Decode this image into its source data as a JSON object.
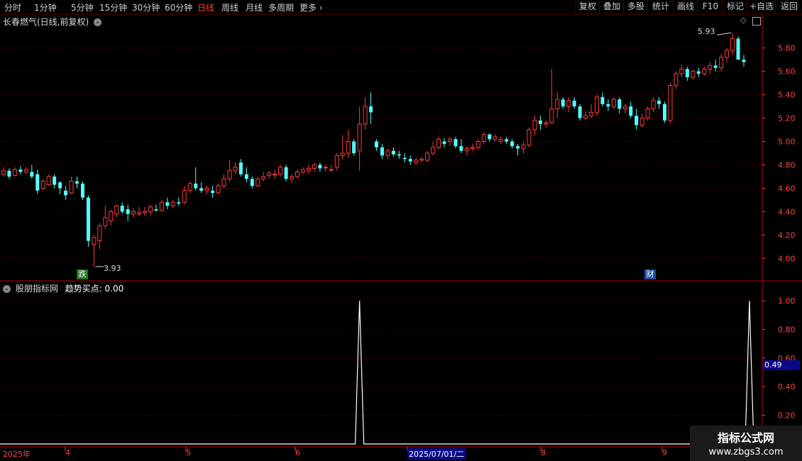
{
  "toolbar": {
    "timeframes": [
      "分时",
      "1分钟",
      "5分钟",
      "15分钟",
      "30分钟",
      "60分钟",
      "日线",
      "周线",
      "月线",
      "多周期",
      "更多"
    ],
    "active_timeframe": "日线",
    "right_buttons": [
      "复权",
      "叠加",
      "多股",
      "统计",
      "画线",
      "F10",
      "+自选",
      "返回"
    ]
  },
  "main_panel": {
    "title": "长春燃气(日线,前复权)",
    "high_label": "5.93",
    "low_label": "3.93",
    "marker_left": "跌",
    "marker_right": "财"
  },
  "indicator_panel": {
    "title": "股朋指标网",
    "series_label": "趋势买点: 0.00",
    "cursor_value": "0.49"
  },
  "date_axis": {
    "labels": [
      "2025年",
      "4",
      "5",
      "6",
      "2025/07/01/二",
      "8",
      "9"
    ]
  },
  "watermark": {
    "line1": "指标公式网",
    "line2": "www.zbgs3.com"
  },
  "colors": {
    "up": "#ff3b3b",
    "down": "#54ffff",
    "grid": "#7a0000",
    "axis": "#ff4444",
    "indicator": "#ffffff"
  },
  "chart_data": [
    {
      "type": "candlestick",
      "title": "长春燃气(日线,前复权)",
      "ylim": [
        3.82,
        5.98
      ],
      "y_ticks": [
        4.0,
        4.2,
        4.4,
        4.6,
        4.8,
        5.0,
        5.2,
        5.4,
        5.6,
        5.8
      ],
      "x_tick_labels": [
        "2025年",
        "4",
        "5",
        "6",
        "2025/07/01/二",
        "8",
        "9"
      ],
      "annotations": [
        {
          "text": "5.93",
          "type": "high"
        },
        {
          "text": "3.93",
          "type": "low"
        }
      ],
      "ohlc": [
        [
          4.72,
          4.78,
          4.7,
          4.75
        ],
        [
          4.75,
          4.77,
          4.68,
          4.7
        ],
        [
          4.71,
          4.78,
          4.7,
          4.76
        ],
        [
          4.76,
          4.79,
          4.72,
          4.74
        ],
        [
          4.74,
          4.78,
          4.72,
          4.76
        ],
        [
          4.74,
          4.8,
          4.68,
          4.7
        ],
        [
          4.72,
          4.76,
          4.55,
          4.58
        ],
        [
          4.6,
          4.68,
          4.58,
          4.66
        ],
        [
          4.63,
          4.72,
          4.62,
          4.7
        ],
        [
          4.7,
          4.72,
          4.6,
          4.63
        ],
        [
          4.65,
          4.66,
          4.55,
          4.6
        ],
        [
          4.58,
          4.62,
          4.5,
          4.54
        ],
        [
          4.56,
          4.7,
          4.55,
          4.66
        ],
        [
          4.66,
          4.7,
          4.6,
          4.64
        ],
        [
          4.64,
          4.66,
          4.5,
          4.52
        ],
        [
          4.52,
          4.54,
          4.1,
          4.15
        ],
        [
          4.12,
          4.2,
          3.93,
          4.18
        ],
        [
          4.15,
          4.3,
          4.08,
          4.28
        ],
        [
          4.28,
          4.45,
          4.25,
          4.35
        ],
        [
          4.32,
          4.42,
          4.28,
          4.4
        ],
        [
          4.38,
          4.46,
          4.35,
          4.45
        ],
        [
          4.45,
          4.48,
          4.38,
          4.4
        ],
        [
          4.42,
          4.46,
          4.32,
          4.38
        ],
        [
          4.38,
          4.43,
          4.35,
          4.4
        ],
        [
          4.38,
          4.44,
          4.36,
          4.39
        ],
        [
          4.39,
          4.44,
          4.36,
          4.4
        ],
        [
          4.4,
          4.46,
          4.37,
          4.44
        ],
        [
          4.42,
          4.46,
          4.4,
          4.41
        ],
        [
          4.41,
          4.5,
          4.4,
          4.48
        ],
        [
          4.48,
          4.52,
          4.42,
          4.45
        ],
        [
          4.45,
          4.5,
          4.43,
          4.48
        ],
        [
          4.48,
          4.52,
          4.45,
          4.47
        ],
        [
          4.48,
          4.62,
          4.46,
          4.58
        ],
        [
          4.58,
          4.66,
          4.56,
          4.64
        ],
        [
          4.64,
          4.78,
          4.58,
          4.6
        ],
        [
          4.6,
          4.65,
          4.56,
          4.58
        ],
        [
          4.58,
          4.62,
          4.55,
          4.6
        ],
        [
          4.58,
          4.62,
          4.52,
          4.56
        ],
        [
          4.56,
          4.64,
          4.55,
          4.62
        ],
        [
          4.62,
          4.72,
          4.6,
          4.68
        ],
        [
          4.68,
          4.84,
          4.66,
          4.75
        ],
        [
          4.75,
          4.82,
          4.72,
          4.78
        ],
        [
          4.82,
          4.85,
          4.7,
          4.72
        ],
        [
          4.72,
          4.78,
          4.65,
          4.68
        ],
        [
          4.68,
          4.7,
          4.6,
          4.62
        ],
        [
          4.62,
          4.7,
          4.61,
          4.68
        ],
        [
          4.68,
          4.74,
          4.66,
          4.7
        ],
        [
          4.71,
          4.75,
          4.68,
          4.73
        ],
        [
          4.72,
          4.76,
          4.68,
          4.72
        ],
        [
          4.72,
          4.8,
          4.7,
          4.78
        ],
        [
          4.78,
          4.8,
          4.66,
          4.68
        ],
        [
          4.68,
          4.72,
          4.64,
          4.7
        ],
        [
          4.7,
          4.76,
          4.68,
          4.74
        ],
        [
          4.74,
          4.78,
          4.72,
          4.76
        ],
        [
          4.75,
          4.8,
          4.72,
          4.77
        ],
        [
          4.77,
          4.82,
          4.74,
          4.8
        ],
        [
          4.8,
          4.82,
          4.74,
          4.77
        ],
        [
          4.78,
          4.8,
          4.74,
          4.78
        ],
        [
          4.76,
          4.8,
          4.74,
          4.76
        ],
        [
          4.78,
          4.9,
          4.75,
          4.88
        ],
        [
          4.88,
          5.05,
          4.85,
          4.9
        ],
        [
          4.9,
          5.1,
          4.86,
          5.0
        ],
        [
          5.0,
          5.02,
          4.88,
          4.9
        ],
        [
          4.92,
          5.3,
          4.75,
          5.15
        ],
        [
          5.15,
          5.38,
          5.1,
          5.3
        ],
        [
          5.3,
          5.42,
          5.15,
          5.25
        ],
        [
          5.0,
          5.02,
          4.92,
          4.95
        ],
        [
          4.95,
          4.98,
          4.85,
          4.88
        ],
        [
          4.88,
          4.94,
          4.85,
          4.92
        ],
        [
          4.92,
          4.95,
          4.87,
          4.89
        ],
        [
          4.89,
          4.92,
          4.85,
          4.88
        ],
        [
          4.86,
          4.9,
          4.82,
          4.85
        ],
        [
          4.85,
          4.88,
          4.8,
          4.83
        ],
        [
          4.82,
          4.86,
          4.8,
          4.84
        ],
        [
          4.84,
          4.87,
          4.82,
          4.85
        ],
        [
          4.84,
          4.92,
          4.82,
          4.9
        ],
        [
          4.9,
          5.0,
          4.88,
          4.95
        ],
        [
          4.95,
          5.04,
          4.93,
          5.02
        ],
        [
          5.0,
          5.03,
          4.95,
          4.98
        ],
        [
          5.0,
          5.04,
          4.96,
          5.02
        ],
        [
          5.02,
          5.04,
          4.94,
          4.96
        ],
        [
          4.96,
          5.02,
          4.9,
          4.92
        ],
        [
          4.92,
          4.96,
          4.88,
          4.94
        ],
        [
          4.94,
          4.98,
          4.92,
          4.95
        ],
        [
          4.95,
          5.02,
          4.93,
          5.0
        ],
        [
          5.0,
          5.08,
          4.98,
          5.06
        ],
        [
          5.06,
          5.07,
          5.0,
          5.02
        ],
        [
          5.02,
          5.06,
          5.0,
          5.04
        ],
        [
          5.0,
          5.04,
          4.98,
          5.02
        ],
        [
          5.02,
          5.04,
          4.98,
          5.0
        ],
        [
          5.0,
          5.02,
          4.94,
          4.96
        ],
        [
          4.96,
          4.98,
          4.88,
          4.94
        ],
        [
          4.94,
          5.0,
          4.9,
          4.97
        ],
        [
          4.97,
          5.12,
          4.95,
          5.1
        ],
        [
          5.1,
          5.22,
          5.05,
          5.18
        ],
        [
          5.18,
          5.22,
          5.1,
          5.15
        ],
        [
          5.15,
          5.18,
          5.12,
          5.16
        ],
        [
          5.16,
          5.62,
          5.15,
          5.28
        ],
        [
          5.28,
          5.42,
          5.2,
          5.36
        ],
        [
          5.36,
          5.38,
          5.28,
          5.3
        ],
        [
          5.3,
          5.38,
          5.25,
          5.35
        ],
        [
          5.35,
          5.38,
          5.28,
          5.3
        ],
        [
          5.3,
          5.32,
          5.18,
          5.2
        ],
        [
          5.2,
          5.26,
          5.18,
          5.22
        ],
        [
          5.22,
          5.32,
          5.2,
          5.25
        ],
        [
          5.25,
          5.4,
          5.22,
          5.38
        ],
        [
          5.38,
          5.42,
          5.3,
          5.32
        ],
        [
          5.32,
          5.36,
          5.26,
          5.3
        ],
        [
          5.3,
          5.38,
          5.28,
          5.36
        ],
        [
          5.36,
          5.38,
          5.24,
          5.28
        ],
        [
          5.28,
          5.32,
          5.24,
          5.3
        ],
        [
          5.3,
          5.34,
          5.2,
          5.22
        ],
        [
          5.22,
          5.28,
          5.1,
          5.14
        ],
        [
          5.14,
          5.24,
          5.12,
          5.2
        ],
        [
          5.2,
          5.3,
          5.18,
          5.28
        ],
        [
          5.28,
          5.38,
          5.25,
          5.35
        ],
        [
          5.35,
          5.38,
          5.28,
          5.32
        ],
        [
          5.32,
          5.34,
          5.16,
          5.18
        ],
        [
          5.18,
          5.5,
          5.16,
          5.48
        ],
        [
          5.48,
          5.6,
          5.45,
          5.58
        ],
        [
          5.58,
          5.66,
          5.55,
          5.62
        ],
        [
          5.62,
          5.64,
          5.52,
          5.55
        ],
        [
          5.55,
          5.62,
          5.53,
          5.6
        ],
        [
          5.6,
          5.63,
          5.55,
          5.58
        ],
        [
          5.58,
          5.64,
          5.56,
          5.62
        ],
        [
          5.62,
          5.68,
          5.58,
          5.65
        ],
        [
          5.65,
          5.7,
          5.6,
          5.63
        ],
        [
          5.63,
          5.75,
          5.6,
          5.72
        ],
        [
          5.72,
          5.8,
          5.68,
          5.78
        ],
        [
          5.78,
          5.93,
          5.74,
          5.88
        ],
        [
          5.88,
          5.9,
          5.7,
          5.7
        ],
        [
          5.7,
          5.74,
          5.64,
          5.68
        ]
      ]
    },
    {
      "type": "line",
      "name": "趋势买点",
      "ylim": [
        0,
        1.05
      ],
      "y_ticks": [
        0.2,
        0.4,
        0.6,
        0.8,
        1.0
      ],
      "cursor_value": 0.49,
      "spikes": [
        {
          "index": 63,
          "value": 1.0
        },
        {
          "index": 132,
          "value": 1.0
        }
      ],
      "baseline": 0.0
    }
  ]
}
